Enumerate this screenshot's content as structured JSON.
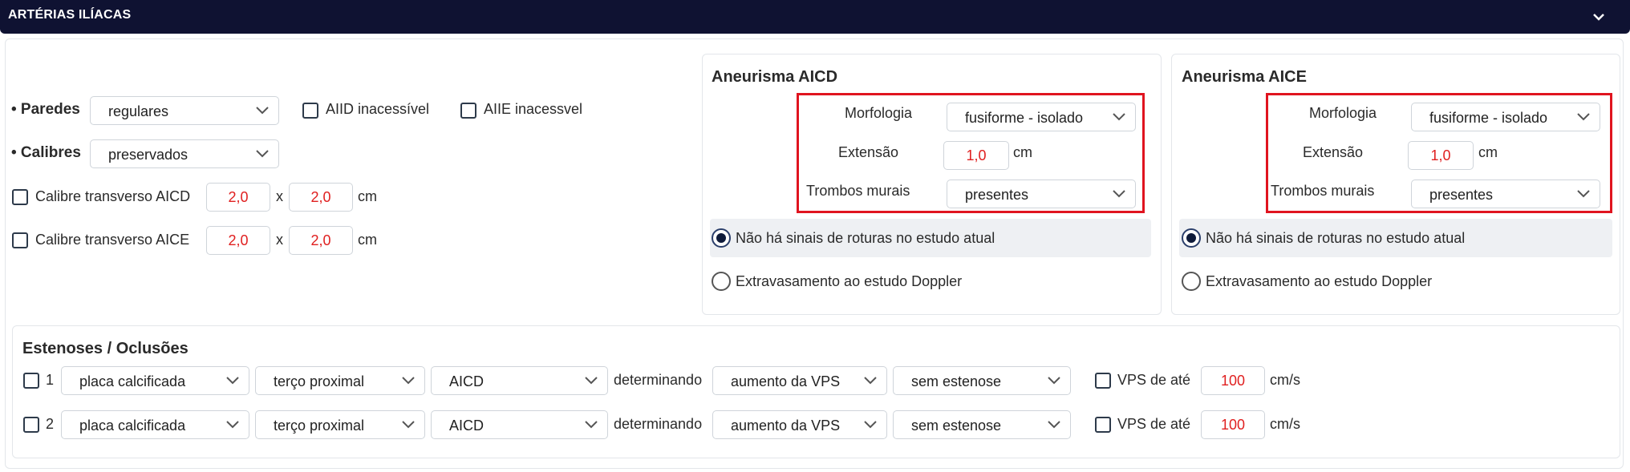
{
  "header": {
    "title": "ARTÉRIAS ILÍACAS",
    "chevron": "chevron-down-icon"
  },
  "left": {
    "paredes": {
      "label": "• Paredes",
      "value": "regulares"
    },
    "calibres": {
      "label": "• Calibres",
      "value": "preservados"
    },
    "aiid": "AIID inacessível",
    "aiie": "AIIE inacessvel",
    "calibre_aicd": {
      "label": "Calibre transverso AICD",
      "a": "2,0",
      "x": "x",
      "b": "2,0",
      "unit": "cm"
    },
    "calibre_aice": {
      "label": "Calibre transverso AICE",
      "a": "2,0",
      "x": "x",
      "b": "2,0",
      "unit": "cm"
    }
  },
  "aicd": {
    "title": "Aneurisma AICD",
    "morfologia_label": "Morfologia",
    "morfologia_value": "fusiforme - isolado",
    "extensao_label": "Extensão",
    "extensao_value": "1,0",
    "extensao_unit": "cm",
    "trombos_label": "Trombos murais",
    "trombos_value": "presentes",
    "radio1": "Não há sinais de roturas no estudo atual",
    "radio2": "Extravasamento ao estudo Doppler"
  },
  "aice": {
    "title": "Aneurisma AICE",
    "morfologia_label": "Morfologia",
    "morfologia_value": "fusiforme - isolado",
    "extensao_label": "Extensão",
    "extensao_value": "1,0",
    "extensao_unit": "cm",
    "trombos_label": "Trombos murais",
    "trombos_value": "presentes",
    "radio1": "Não há sinais de roturas no estudo atual",
    "radio2": "Extravasamento ao estudo Doppler"
  },
  "estenoses": {
    "title": "Estenoses / Oclusões",
    "rows": [
      {
        "index": "1",
        "tipo": "placa calcificada",
        "local": "terço proximal",
        "arteria": "AICD",
        "determinando": "determinando",
        "efeito": "aumento da VPS",
        "grau": "sem estenose",
        "vps_label": "VPS de até",
        "vps_value": "100",
        "vps_unit": "cm/s"
      },
      {
        "index": "2",
        "tipo": "placa calcificada",
        "local": "terço proximal",
        "arteria": "AICD",
        "determinando": "determinando",
        "efeito": "aumento da VPS",
        "grau": "sem estenose",
        "vps_label": "VPS de até",
        "vps_value": "100",
        "vps_unit": "cm/s"
      }
    ]
  },
  "colors": {
    "header_bg": "#0f1232",
    "highlight_border": "#e0141f",
    "number_text": "#e02020"
  }
}
